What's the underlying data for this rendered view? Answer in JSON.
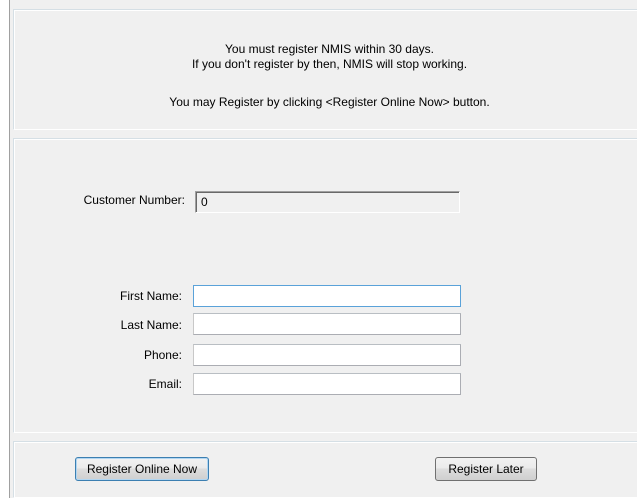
{
  "message": {
    "line1": "You must register NMIS within 30 days.",
    "line2": "If you don't register by then, NMIS will stop working.",
    "line3": "You may Register by clicking <Register Online Now> button."
  },
  "form": {
    "customer_number_label": "Customer Number:",
    "customer_number_value": "0",
    "first_name_label": "First Name:",
    "first_name_value": "",
    "last_name_label": "Last Name:",
    "last_name_value": "",
    "phone_label": "Phone:",
    "phone_value": "",
    "email_label": "Email:",
    "email_value": ""
  },
  "buttons": {
    "register_online_label": "Register Online Now",
    "register_later_label": "Register Later"
  }
}
